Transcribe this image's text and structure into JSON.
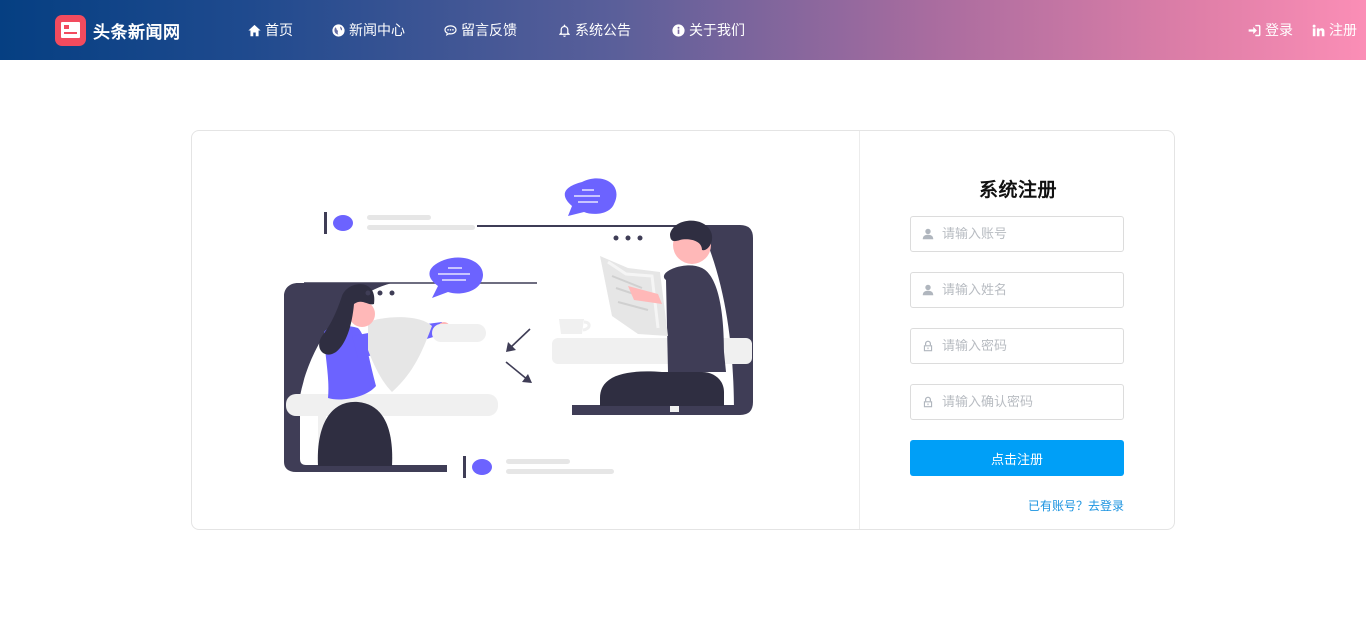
{
  "header": {
    "brand": "头条新闻网",
    "nav": [
      {
        "label": "首页",
        "icon": "home-icon"
      },
      {
        "label": "新闻中心",
        "icon": "globe-icon"
      },
      {
        "label": "留言反馈",
        "icon": "comment-icon"
      },
      {
        "label": "系统公告",
        "icon": "bell-icon"
      },
      {
        "label": "关于我们",
        "icon": "info-icon"
      }
    ],
    "login_label": "登录",
    "register_label": "注册"
  },
  "form": {
    "title": "系统注册",
    "account_placeholder": "请输入账号",
    "name_placeholder": "请输入姓名",
    "password_placeholder": "请输入密码",
    "confirm_placeholder": "请输入确认密码",
    "submit_label": "点击注册",
    "login_link": "已有账号？去登录"
  },
  "colors": {
    "header_gradient_start": "#053f82",
    "header_gradient_end": "#fb8eb6",
    "brand_logo": "#f24b5e",
    "primary_button": "#009ff7",
    "link": "#1a93e0",
    "illustration_accent": "#6c63ff",
    "illustration_dark": "#3f3d56"
  }
}
